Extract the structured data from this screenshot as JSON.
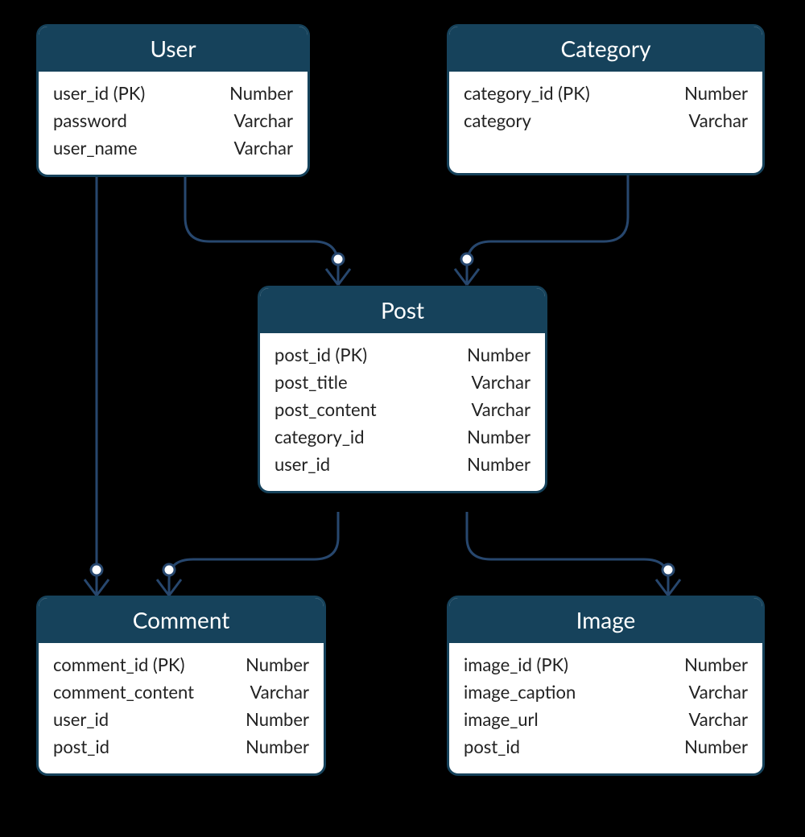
{
  "entities": {
    "user": {
      "title": "User",
      "attrs": [
        {
          "name": "user_id (PK)",
          "type": "Number"
        },
        {
          "name": "password",
          "type": "Varchar"
        },
        {
          "name": "user_name",
          "type": "Varchar"
        }
      ]
    },
    "category": {
      "title": "Category",
      "attrs": [
        {
          "name": "category_id (PK)",
          "type": "Number"
        },
        {
          "name": "category",
          "type": "Varchar"
        }
      ]
    },
    "post": {
      "title": "Post",
      "attrs": [
        {
          "name": "post_id (PK)",
          "type": "Number"
        },
        {
          "name": "post_title",
          "type": "Varchar"
        },
        {
          "name": "post_content",
          "type": "Varchar"
        },
        {
          "name": "category_id",
          "type": "Number"
        },
        {
          "name": "user_id",
          "type": "Number"
        }
      ]
    },
    "comment": {
      "title": "Comment",
      "attrs": [
        {
          "name": "comment_id (PK)",
          "type": "Number"
        },
        {
          "name": "comment_content",
          "type": "Varchar"
        },
        {
          "name": "user_id",
          "type": "Number"
        },
        {
          "name": "post_id",
          "type": "Number"
        }
      ]
    },
    "image": {
      "title": "Image",
      "attrs": [
        {
          "name": "image_id (PK)",
          "type": "Number"
        },
        {
          "name": "image_caption",
          "type": "Varchar"
        },
        {
          "name": "image_url",
          "type": "Varchar"
        },
        {
          "name": "post_id",
          "type": "Number"
        }
      ]
    }
  },
  "colors": {
    "header_bg": "#16425b",
    "border": "#16425b",
    "connector": "#27476e"
  },
  "relationships": [
    {
      "from": "user",
      "to": "post",
      "type": "one-to-many"
    },
    {
      "from": "category",
      "to": "post",
      "type": "one-to-many"
    },
    {
      "from": "user",
      "to": "comment",
      "type": "one-to-many"
    },
    {
      "from": "post",
      "to": "comment",
      "type": "one-to-many"
    },
    {
      "from": "post",
      "to": "image",
      "type": "one-to-many"
    }
  ]
}
